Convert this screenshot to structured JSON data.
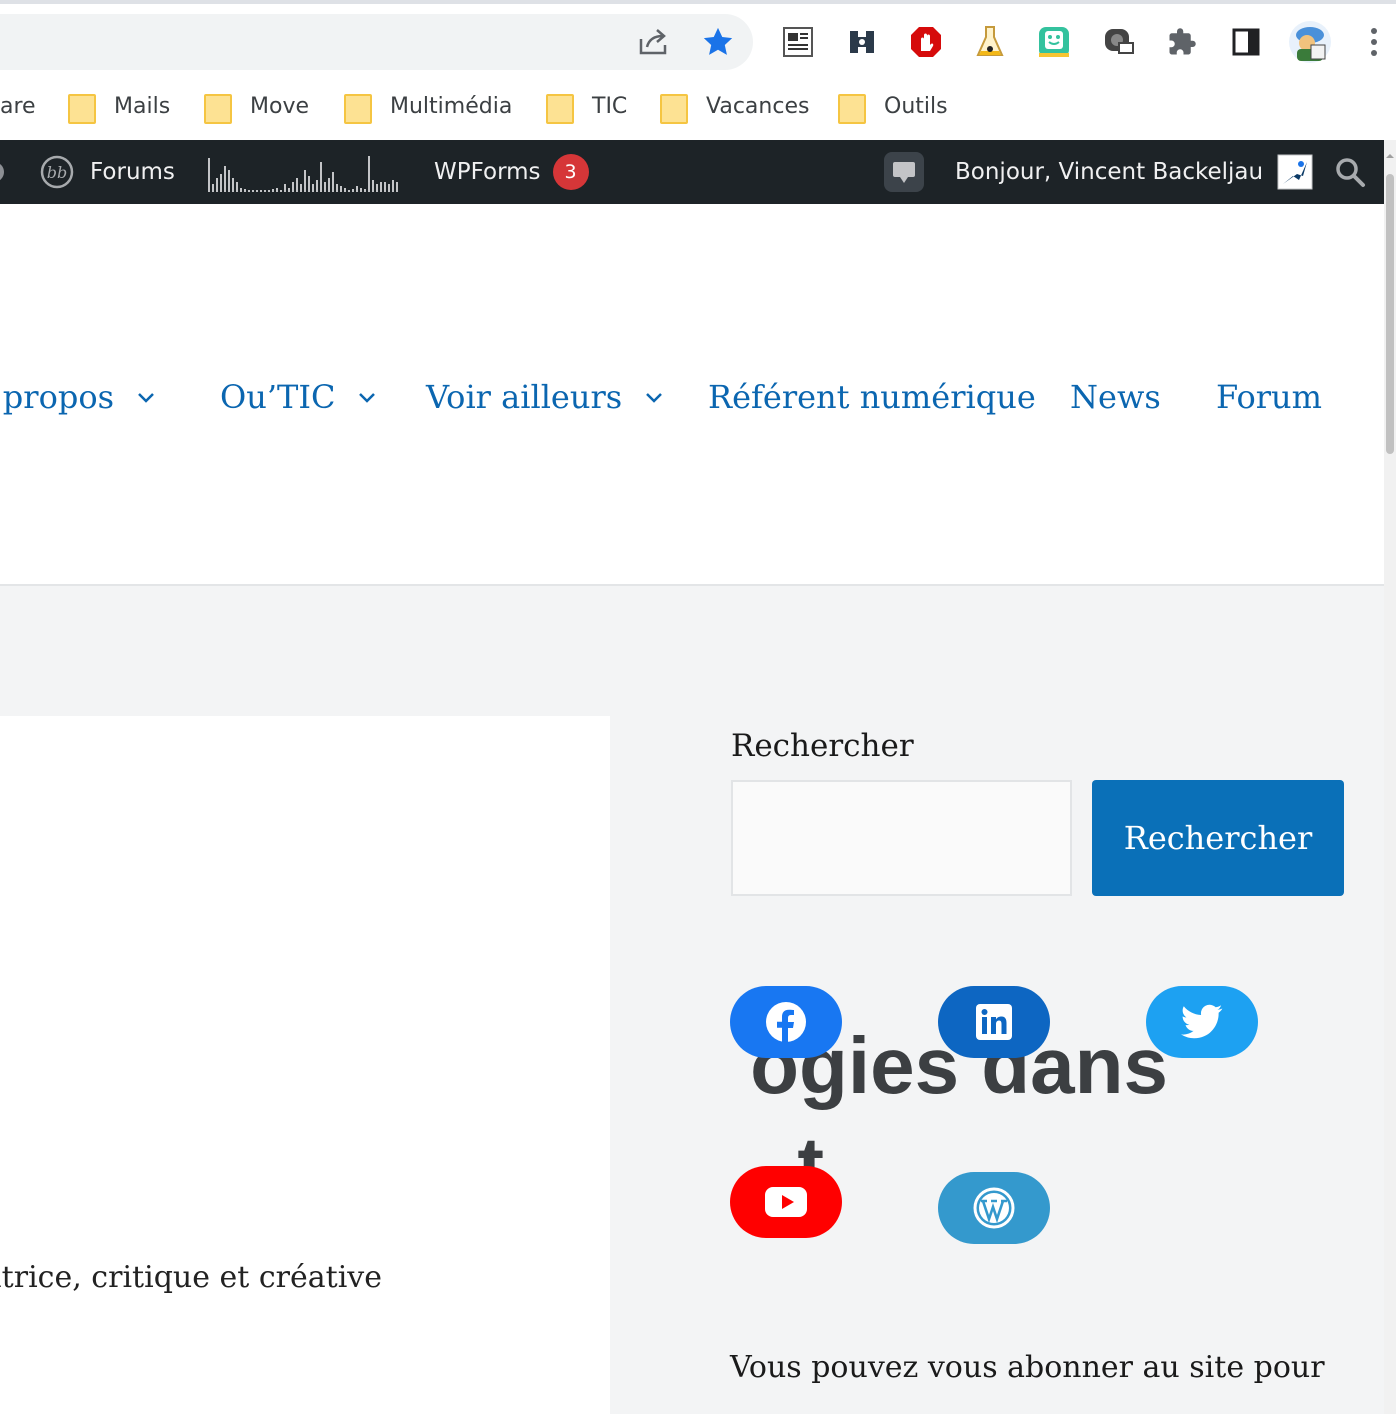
{
  "browser": {
    "bookmarks": [
      {
        "label": "are"
      },
      {
        "label": "Mails"
      },
      {
        "label": "Move"
      },
      {
        "label": "Multimédia"
      },
      {
        "label": "TIC"
      },
      {
        "label": "Vacances"
      },
      {
        "label": "Outils"
      }
    ],
    "extensions": [
      "reader-extension-icon",
      "translate-extension-icon",
      "adblock-icon",
      "flask-extension-icon",
      "smiley-extension-icon",
      "screen-capture-extension-icon",
      "puzzle-icon",
      "side-panel-icon",
      "profile-avatar-icon",
      "kebab-menu-icon"
    ],
    "accent_star": "#1a73e8"
  },
  "adminbar": {
    "forums_label": "Forums",
    "wpforms_label": "WPForms",
    "wpforms_count": "3",
    "greeting": "Bonjour, Vincent Backeljau"
  },
  "nav": {
    "items": [
      {
        "label": "À propos"
      },
      {
        "label": "Ou’TIC"
      },
      {
        "label": "Voir ailleurs"
      },
      {
        "label": "Référent numérique"
      },
      {
        "label": "News"
      },
      {
        "label": "Forum"
      }
    ],
    "color": "#0b66b0"
  },
  "content": {
    "title_line1": "ogies dans",
    "title_line2": "t",
    "subtitle": "atrice, critique et créative"
  },
  "sidebar": {
    "search_label": "Rechercher",
    "search_placeholder": "",
    "search_button": "Rechercher",
    "social": [
      {
        "name": "facebook",
        "color": "#1877f2"
      },
      {
        "name": "linkedin",
        "color": "#0d66c2"
      },
      {
        "name": "twitter",
        "color": "#1da1f2"
      },
      {
        "name": "youtube",
        "color": "#ff0000"
      },
      {
        "name": "wordpress",
        "color": "#3499cd"
      }
    ],
    "subscribe_text": "Vous pouvez vous abonner au site pour"
  }
}
